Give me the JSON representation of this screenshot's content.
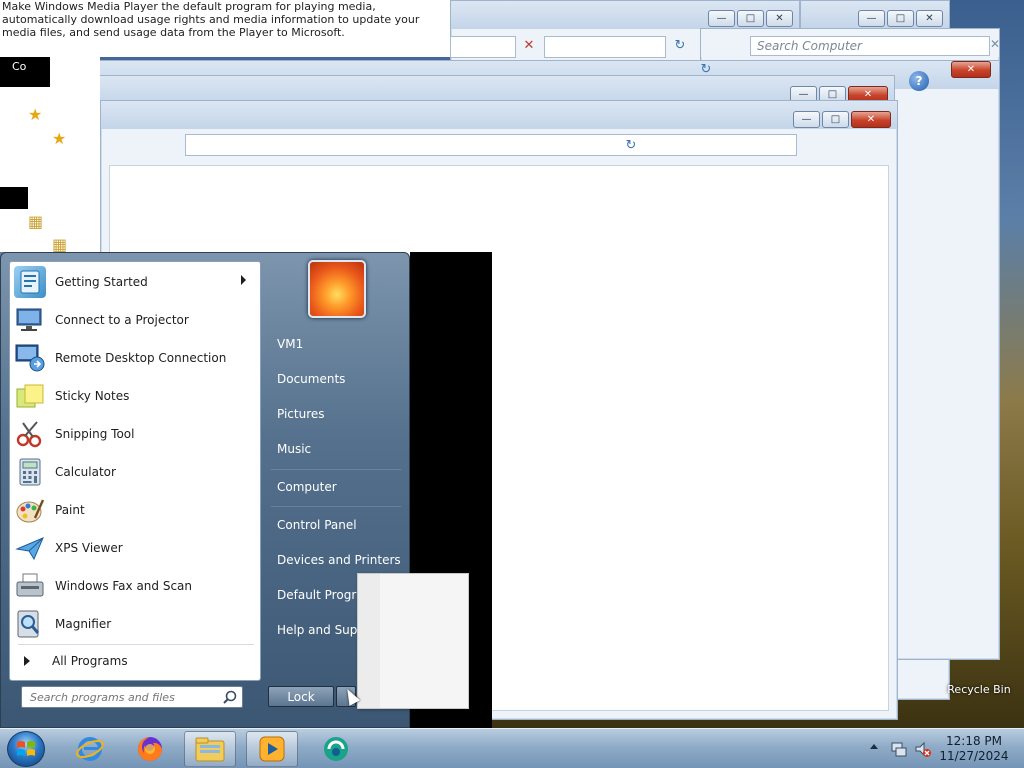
{
  "tooltip": {
    "text": "Make Windows Media Player the default program for playing media, automatically download usage rights and media information to update your media files, and send usage data from the Player to Microsoft."
  },
  "explorer": {
    "search_placeholder": "Search Computer",
    "sliver_label": "Co"
  },
  "start_menu": {
    "programs": [
      {
        "label": "Getting Started",
        "icon": "getting-started-icon",
        "has_submenu": true
      },
      {
        "label": "Connect to a Projector",
        "icon": "projector-icon"
      },
      {
        "label": "Remote Desktop Connection",
        "icon": "remote-desktop-icon"
      },
      {
        "label": "Sticky Notes",
        "icon": "sticky-notes-icon"
      },
      {
        "label": "Snipping Tool",
        "icon": "snipping-tool-icon"
      },
      {
        "label": "Calculator",
        "icon": "calculator-icon"
      },
      {
        "label": "Paint",
        "icon": "paint-icon"
      },
      {
        "label": "XPS Viewer",
        "icon": "xps-viewer-icon"
      },
      {
        "label": "Windows Fax and Scan",
        "icon": "fax-scan-icon"
      },
      {
        "label": "Magnifier",
        "icon": "magnifier-icon"
      }
    ],
    "all_programs": "All Programs",
    "search_placeholder": "Search programs and files",
    "right_items": [
      {
        "label": "VM1"
      },
      {
        "label": "Documents"
      },
      {
        "label": "Pictures"
      },
      {
        "label": "Music"
      },
      {
        "label": "Computer"
      },
      {
        "label": "Control Panel"
      },
      {
        "label": "Devices and Printers"
      },
      {
        "label": "Default Programs"
      },
      {
        "label": "Help and Support"
      }
    ],
    "lock_label": "Lock"
  },
  "desktop": {
    "recycle_bin_label": "Recycle Bin"
  },
  "taskbar": {
    "apps": [
      "internet-explorer-icon",
      "firefox-icon",
      "file-explorer-icon",
      "media-player-icon",
      "app-icon"
    ],
    "time": "12:18 PM",
    "date": "11/27/2024"
  },
  "colors": {
    "taskbar": "#8fabc7",
    "start_menu": "#54708c",
    "close_button": "#c7432b"
  }
}
